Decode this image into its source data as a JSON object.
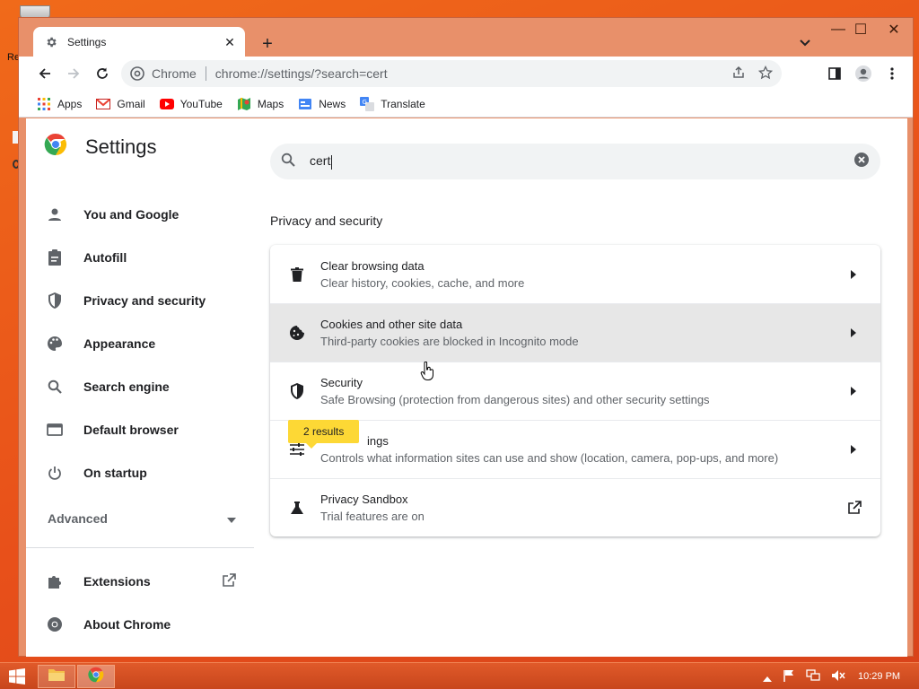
{
  "desktop": {
    "label": "Re"
  },
  "window": {
    "tab_title": "Settings",
    "new_tab_label": "+",
    "controls": {
      "minimize": "—",
      "maximize": "☐",
      "close": "✕"
    }
  },
  "omnibox": {
    "site_chip": "Chrome",
    "url": "chrome://settings/?search=cert"
  },
  "bookmarks": [
    {
      "label": "Apps",
      "icon": "apps-grid-icon"
    },
    {
      "label": "Gmail",
      "icon": "gmail-icon"
    },
    {
      "label": "YouTube",
      "icon": "youtube-icon"
    },
    {
      "label": "Maps",
      "icon": "maps-icon"
    },
    {
      "label": "News",
      "icon": "news-icon"
    },
    {
      "label": "Translate",
      "icon": "translate-icon"
    }
  ],
  "sidebar": {
    "title": "Settings",
    "items": [
      {
        "label": "You and Google",
        "icon": "person-icon"
      },
      {
        "label": "Autofill",
        "icon": "clipboard-icon"
      },
      {
        "label": "Privacy and security",
        "icon": "shield-icon"
      },
      {
        "label": "Appearance",
        "icon": "palette-icon"
      },
      {
        "label": "Search engine",
        "icon": "search-icon"
      },
      {
        "label": "Default browser",
        "icon": "browser-window-icon"
      },
      {
        "label": "On startup",
        "icon": "power-icon"
      }
    ],
    "advanced_label": "Advanced",
    "footer_items": [
      {
        "label": "Extensions",
        "icon": "puzzle-icon"
      },
      {
        "label": "About Chrome",
        "icon": "chrome-icon"
      }
    ]
  },
  "search": {
    "query": "cert"
  },
  "section": {
    "title": "Privacy and security",
    "rows": [
      {
        "title": "Clear browsing data",
        "subtitle": "Clear history, cookies, cache, and more",
        "icon": "trash-icon"
      },
      {
        "title": "Cookies and other site data",
        "subtitle": "Third-party cookies are blocked in Incognito mode",
        "icon": "cookie-icon"
      },
      {
        "title": "Security",
        "subtitle": "Safe Browsing (protection from dangerous sites) and other security settings",
        "icon": "shield-icon"
      },
      {
        "title_visible": "ings",
        "subtitle": "Controls what information sites can use and show (location, camera, pop-ups, and more)",
        "icon": "tune-sliders-icon"
      },
      {
        "title": "Privacy Sandbox",
        "subtitle": "Trial features are on",
        "icon": "flask-icon"
      }
    ]
  },
  "results_bubble": "2 results",
  "taskbar": {
    "clock": "10:29 PM"
  },
  "colors": {
    "accent": "#1a73e8",
    "highlight_row": "#e7e7e7",
    "bubble": "#fdd835",
    "desktop": "#e8501a"
  }
}
